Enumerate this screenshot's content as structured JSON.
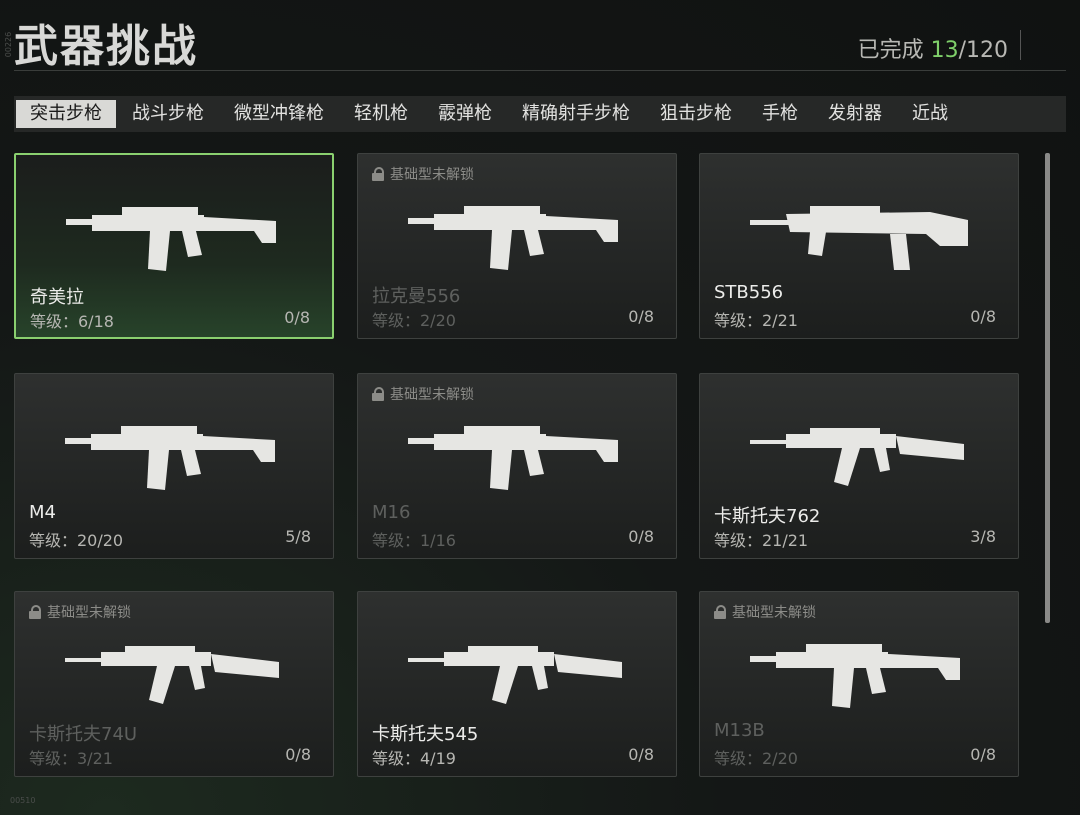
{
  "header": {
    "title": "武器挑战",
    "progress_label": "已完成",
    "progress_done": "13",
    "progress_total": "/120"
  },
  "tabs": [
    {
      "label": "突击步枪",
      "active": true
    },
    {
      "label": "战斗步枪"
    },
    {
      "label": "微型冲锋枪"
    },
    {
      "label": "轻机枪"
    },
    {
      "label": "霰弹枪"
    },
    {
      "label": "精确射手步枪"
    },
    {
      "label": "狙击步枪"
    },
    {
      "label": "手枪"
    },
    {
      "label": "发射器"
    },
    {
      "label": "近战"
    }
  ],
  "locked_label": "基础型未解锁",
  "weapons": [
    {
      "name": "奇美拉",
      "level": "等级：6/18",
      "count": "0/8",
      "locked": false,
      "selected": true,
      "icon": "rifle-icon"
    },
    {
      "name": "拉克曼556",
      "level": "等级：2/20",
      "count": "0/8",
      "locked": true,
      "icon": "rifle-icon"
    },
    {
      "name": "STB556",
      "level": "等级：2/21",
      "count": "0/8",
      "locked": false,
      "icon": "bullpup-rifle-icon"
    },
    {
      "name": "M4",
      "level": "等级：20/20",
      "count": "5/8",
      "locked": false,
      "icon": "rifle-icon"
    },
    {
      "name": "M16",
      "level": "等级：1/16",
      "count": "0/8",
      "locked": true,
      "icon": "rifle-icon"
    },
    {
      "name": "卡斯托夫762",
      "level": "等级：21/21",
      "count": "3/8",
      "locked": false,
      "icon": "ak-rifle-icon"
    },
    {
      "name": "卡斯托夫74U",
      "level": "等级：3/21",
      "count": "0/8",
      "locked": true,
      "icon": "ak-rifle-icon"
    },
    {
      "name": "卡斯托夫545",
      "level": "等级：4/19",
      "count": "0/8",
      "locked": false,
      "icon": "ak-rifle-icon"
    },
    {
      "name": "M13B",
      "level": "等级：2/20",
      "count": "0/8",
      "locked": true,
      "icon": "rifle-icon"
    }
  ],
  "corner_tag": "00510",
  "side_tag": "00226"
}
